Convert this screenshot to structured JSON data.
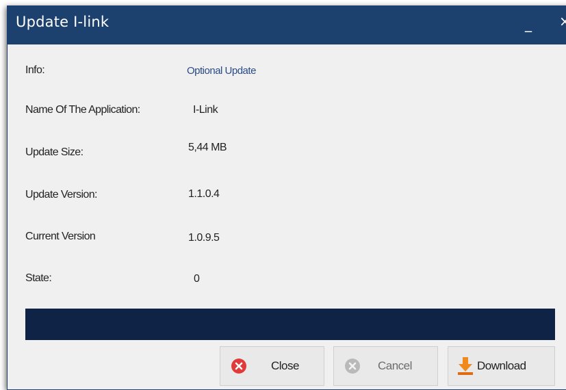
{
  "window": {
    "title": "Update I-link",
    "minimize_glyph": "_",
    "close_glyph": "×"
  },
  "fields": {
    "info_label": "Info:",
    "info_value": "Optional Update",
    "app_name_label": "Name Of The Application:",
    "app_name_value": "I-Link",
    "size_label": "Update Size:",
    "size_value": "5,44 MB",
    "update_version_label": "Update Version:",
    "update_version_value": "1.1.0.4",
    "current_version_label": "Current Version",
    "current_version_value": "1.0.9.5",
    "state_label": "State:",
    "state_value": "0"
  },
  "progress": {
    "fraction": 0
  },
  "buttons": {
    "close_label": "Close",
    "cancel_label": "Cancel",
    "download_label": "Download"
  },
  "icons": {
    "close": "close-circle-icon",
    "cancel": "cancel-circle-icon",
    "download": "download-arrow-icon"
  },
  "colors": {
    "titlebar": "#1d416f",
    "link_text": "#2a4a85",
    "progress_track": "#0f2347",
    "close_icon": "#e03a3a",
    "download_arrow": "#f08a1c"
  }
}
